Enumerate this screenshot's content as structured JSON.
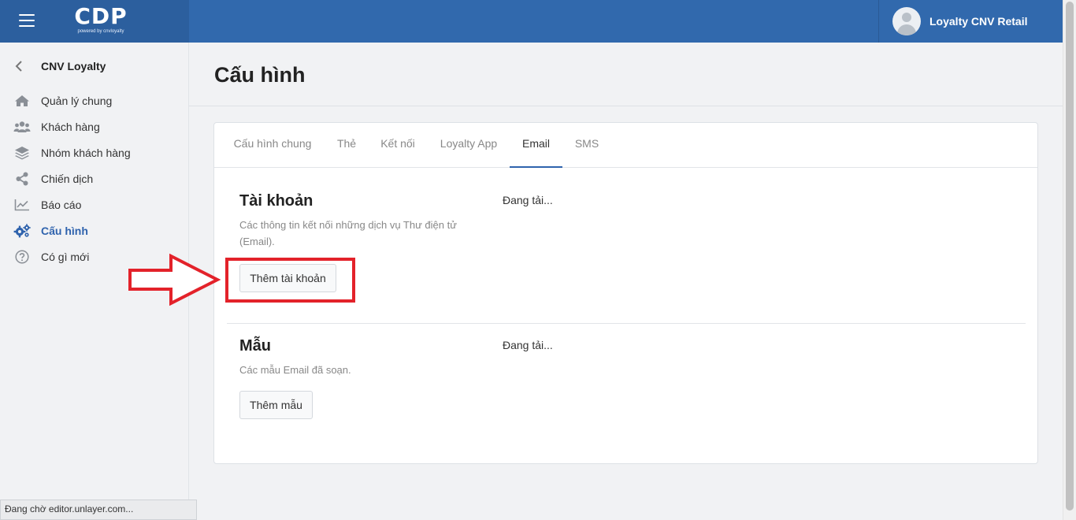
{
  "header": {
    "logo_main": "CDP",
    "logo_sub": "powered by cnvloyalty",
    "user_name": "Loyalty CNV Retail"
  },
  "sidebar": {
    "back_title": "CNV Loyalty",
    "items": [
      {
        "label": "Quản lý chung",
        "icon": "home-icon"
      },
      {
        "label": "Khách hàng",
        "icon": "users-icon"
      },
      {
        "label": "Nhóm khách hàng",
        "icon": "layers-icon"
      },
      {
        "label": "Chiến dịch",
        "icon": "share-icon"
      },
      {
        "label": "Báo cáo",
        "icon": "chart-icon"
      },
      {
        "label": "Cấu hình",
        "icon": "gears-icon",
        "active": true
      },
      {
        "label": "Có gì mới",
        "icon": "question-icon"
      }
    ]
  },
  "page": {
    "title": "Cấu hình"
  },
  "tabs": [
    {
      "label": "Cấu hình chung"
    },
    {
      "label": "Thẻ"
    },
    {
      "label": "Kết nối"
    },
    {
      "label": "Loyalty App"
    },
    {
      "label": "Email",
      "active": true
    },
    {
      "label": "SMS"
    }
  ],
  "account_section": {
    "title": "Tài khoản",
    "description": "Các thông tin kết nối những dịch vụ Thư điện tử (Email).",
    "button_label": "Thêm tài khoản",
    "loading_text": "Đang tải..."
  },
  "template_section": {
    "title": "Mẫu",
    "description": "Các mẫu Email đã soạn.",
    "button_label": "Thêm mẫu",
    "loading_text": "Đang tải..."
  },
  "status_bar": {
    "text": "Đang chờ editor.unlayer.com..."
  },
  "colors": {
    "header_bg": "#3169ad",
    "accent": "#2f63ad",
    "annotation_red": "#e3222a"
  }
}
